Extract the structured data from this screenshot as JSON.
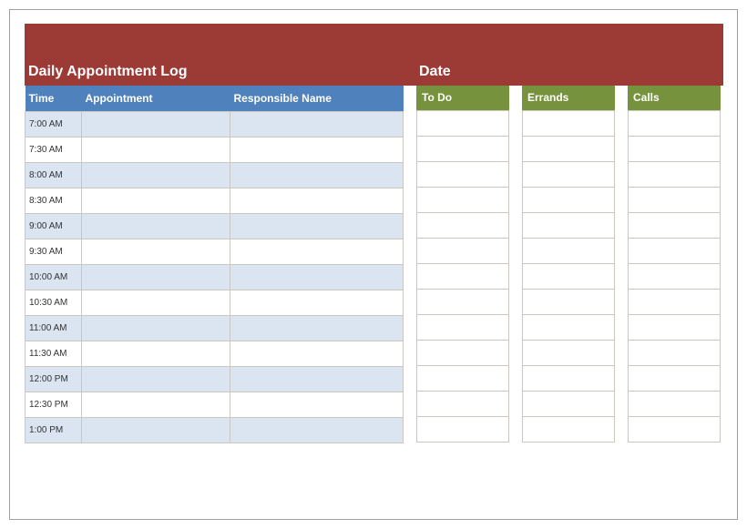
{
  "header": {
    "title_left": "Daily Appointment Log",
    "title_right": "Date"
  },
  "appt_table": {
    "headers": {
      "time": "Time",
      "appointment": "Appointment",
      "responsible": "Responsible Name"
    },
    "rows": [
      {
        "time": "7:00 AM",
        "appointment": "",
        "responsible": ""
      },
      {
        "time": "7:30 AM",
        "appointment": "",
        "responsible": ""
      },
      {
        "time": "8:00 AM",
        "appointment": "",
        "responsible": ""
      },
      {
        "time": "8:30 AM",
        "appointment": "",
        "responsible": ""
      },
      {
        "time": "9:00 AM",
        "appointment": "",
        "responsible": ""
      },
      {
        "time": "9:30 AM",
        "appointment": "",
        "responsible": ""
      },
      {
        "time": "10:00 AM",
        "appointment": "",
        "responsible": ""
      },
      {
        "time": "10:30 AM",
        "appointment": "",
        "responsible": ""
      },
      {
        "time": "11:00 AM",
        "appointment": "",
        "responsible": ""
      },
      {
        "time": "11:30 AM",
        "appointment": "",
        "responsible": ""
      },
      {
        "time": "12:00 PM",
        "appointment": "",
        "responsible": ""
      },
      {
        "time": "12:30 PM",
        "appointment": "",
        "responsible": ""
      },
      {
        "time": "1:00 PM",
        "appointment": "",
        "responsible": ""
      }
    ]
  },
  "side_columns": [
    {
      "header": "To Do",
      "rows": [
        "",
        "",
        "",
        "",
        "",
        "",
        "",
        "",
        "",
        "",
        "",
        "",
        ""
      ]
    },
    {
      "header": "Errands",
      "rows": [
        "",
        "",
        "",
        "",
        "",
        "",
        "",
        "",
        "",
        "",
        "",
        "",
        ""
      ]
    },
    {
      "header": "Calls",
      "rows": [
        "",
        "",
        "",
        "",
        "",
        "",
        "",
        "",
        "",
        "",
        "",
        "",
        ""
      ]
    }
  ],
  "colors": {
    "header_bar": "#9c3a35",
    "appt_header": "#4f81bd",
    "side_header": "#76923c",
    "row_odd": "#dbe5f1",
    "row_even": "#ffffff",
    "border": "#ccc6c0"
  }
}
